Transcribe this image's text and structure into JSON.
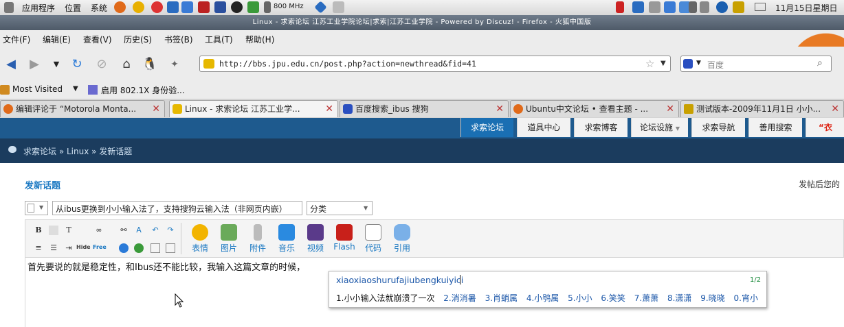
{
  "panel": {
    "menus": [
      "应用程序",
      "位置",
      "系统"
    ],
    "cpu": "800 MHz",
    "datetime": "11月15日星期日"
  },
  "window": {
    "title": "Linux - 求索论坛 江苏工业学院论坛|求索|江苏工业学院 - Powered by Discuz! - Firefox - 火狐中国版"
  },
  "menubar": [
    "文件(F)",
    "编辑(E)",
    "查看(V)",
    "历史(S)",
    "书签(B)",
    "工具(T)",
    "帮助(H)"
  ],
  "navbar": {
    "url": "http://bbs.jpu.edu.cn/post.php?action=newthread&fid=41",
    "search_placeholder": "百度"
  },
  "bookmarks": [
    "Most Visited",
    "启用 802.1X 身份验..."
  ],
  "tabs": [
    {
      "label": "编辑评论于 “Motorola Monta...",
      "active": false
    },
    {
      "label": "Linux - 求索论坛 江苏工业学...",
      "active": true
    },
    {
      "label": "百度搜索_ibus 搜狗",
      "active": false
    },
    {
      "label": "Ubuntu中文论坛 • 查看主题 - ...",
      "active": false
    },
    {
      "label": "测试版本-2009年11月1日 小小...",
      "active": false
    }
  ],
  "forum_nav": [
    "求索论坛",
    "道具中心",
    "求索博客",
    "论坛设施",
    "求索导航",
    "善用搜索",
    "“衣"
  ],
  "breadcrumb": "求索论坛 » Linux » 发新话题",
  "page": {
    "title": "发新话题",
    "right_note": "发帖后您的",
    "subject": "从ibus更换到小小输入法了，支持搜狗云输入法（非网页内嵌）",
    "category": "分类"
  },
  "editor_tools": [
    "表情",
    "图片",
    "附件",
    "音乐",
    "视频",
    "Flash",
    "代码",
    "引用"
  ],
  "editor_text": "首先要说的就是稳定性，和Ibus还不能比较，我输入这篇文章的时候，",
  "ime": {
    "pinyin": "xiaoxiaoshurufajiubengkuiyici",
    "page": "1/2",
    "candidates": [
      "1.小小输入法就崩溃了一次",
      "2.消消暑",
      "3.肖蛸属",
      "4.小鸮属",
      "5.小小",
      "6.笑笑",
      "7.萧萧",
      "8.潇潇",
      "9.晓晓",
      "0.宵小"
    ]
  },
  "colors": {
    "forum_nav_bg": "#1e5a8e",
    "forum_nav_active": "#1a6fb3",
    "band": "#1b3c5e",
    "accent": "#1a78c2"
  }
}
